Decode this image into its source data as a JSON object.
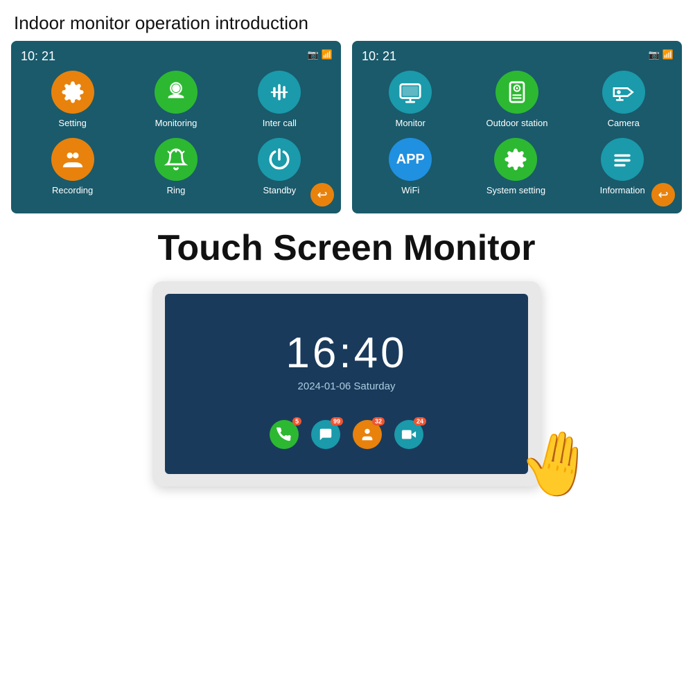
{
  "page": {
    "title": "Indoor monitor operation introduction"
  },
  "panel_left": {
    "time": "10: 21",
    "icons": [
      {
        "label": "Setting",
        "color": "orange",
        "icon": "gear"
      },
      {
        "label": "Monitoring",
        "color": "green",
        "icon": "camera-person"
      },
      {
        "label": "Inter call",
        "color": "teal",
        "icon": "sliders"
      }
    ],
    "icons2": [
      {
        "label": "Recording",
        "color": "orange",
        "icon": "people"
      },
      {
        "label": "Ring",
        "color": "green",
        "icon": "bell"
      },
      {
        "label": "Standby",
        "color": "teal",
        "icon": "power"
      }
    ]
  },
  "panel_right": {
    "time": "10: 21",
    "icons": [
      {
        "label": "Monitor",
        "color": "teal",
        "icon": "monitor"
      },
      {
        "label": "Outdoor station",
        "color": "green",
        "icon": "outdoor"
      },
      {
        "label": "Camera",
        "color": "teal",
        "icon": "cctv"
      }
    ],
    "icons2": [
      {
        "label": "WiFi",
        "color": "blue-app",
        "icon": "wifi-app"
      },
      {
        "label": "System setting",
        "color": "green",
        "icon": "gear2"
      },
      {
        "label": "Information",
        "color": "teal",
        "icon": "list"
      }
    ]
  },
  "touch_screen": {
    "title": "Touch Screen Monitor",
    "clock": "16:40",
    "date": "2024-01-06  Saturday",
    "bottom_icons": [
      {
        "color": "green",
        "icon": "phone",
        "badge": "5"
      },
      {
        "color": "teal",
        "icon": "chat",
        "badge": "99"
      },
      {
        "color": "orange",
        "icon": "person",
        "badge": "32"
      },
      {
        "color": "teal-dark",
        "icon": "video",
        "badge": "24"
      }
    ]
  }
}
